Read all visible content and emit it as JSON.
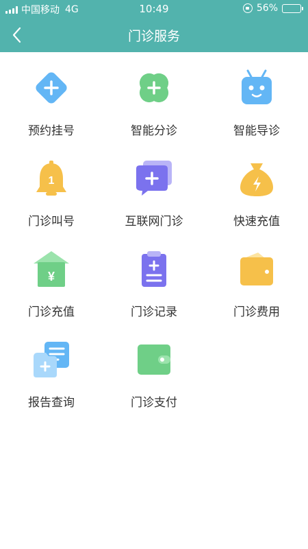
{
  "status_bar": {
    "carrier": "中国移动",
    "network": "4G",
    "time": "10:49",
    "battery": "56%",
    "battery_level": 0.56
  },
  "nav": {
    "title": "门诊服务",
    "back_icon": "chevron-left-icon"
  },
  "colors": {
    "header": "#52b3ad",
    "blue": "#63b6f5",
    "green": "#6fcf87",
    "yellow": "#f6c04a",
    "purple": "#7b72ee",
    "text": "#333333"
  },
  "services": [
    {
      "label": "预约挂号",
      "icon": "add-diamond-icon"
    },
    {
      "label": "智能分诊",
      "icon": "add-clover-icon"
    },
    {
      "label": "智能导诊",
      "icon": "robot-icon"
    },
    {
      "label": "门诊叫号",
      "icon": "bell-icon"
    },
    {
      "label": "互联网门诊",
      "icon": "chat-add-icon"
    },
    {
      "label": "快速充值",
      "icon": "money-bag-icon"
    },
    {
      "label": "门诊充值",
      "icon": "yuan-house-icon"
    },
    {
      "label": "门诊记录",
      "icon": "clipboard-icon"
    },
    {
      "label": "门诊费用",
      "icon": "wallet-icon"
    },
    {
      "label": "报告查询",
      "icon": "report-icon"
    },
    {
      "label": "门诊支付",
      "icon": "card-wallet-icon"
    }
  ]
}
